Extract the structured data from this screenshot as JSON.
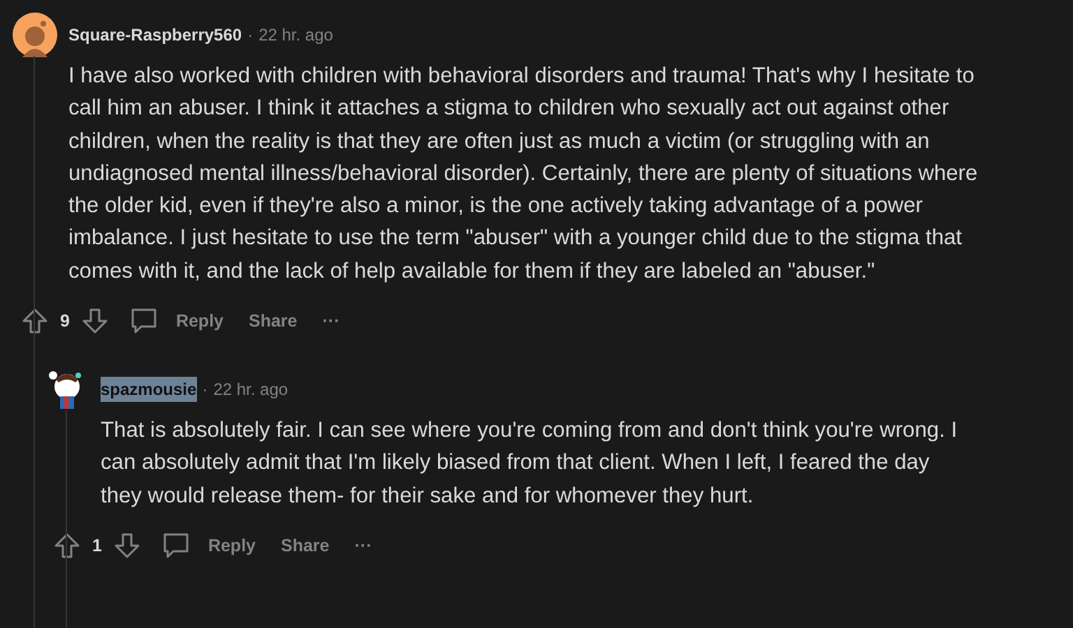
{
  "comments": [
    {
      "author": "Square-Raspberry560",
      "highlighted": false,
      "time": "22 hr. ago",
      "body": "I have also worked with children with behavioral disorders and trauma! That's why I hesitate to call him an abuser. I think it attaches a stigma to children who sexually act out against other children, when the reality is that they are often just as much a victim (or struggling with an undiagnosed mental illness/behavioral disorder). Certainly, there are plenty of situations where the older kid, even if they're also a minor, is the one actively taking advantage of a power imbalance. I just hesitate to use the term \"abuser\" with a younger child due to the stigma that comes with it, and the lack of help available for them if they are labeled an \"abuser.\"",
      "score": "9",
      "reply": "Reply",
      "share": "Share",
      "more": "···",
      "avatar": {
        "kind": "plain"
      },
      "separator": "·",
      "children": [
        {
          "author": "spazmousie",
          "highlighted": true,
          "time": "22 hr. ago",
          "body": "That is absolutely fair. I can see where you're coming from and don't think you're wrong. I can absolutely admit that I'm likely biased from that client. When I left, I feared the day they would release them- for their sake and for whomever they hurt.",
          "score": "1",
          "reply": "Reply",
          "share": "Share",
          "more": "···",
          "avatar": {
            "kind": "character"
          },
          "separator": "·"
        }
      ]
    }
  ]
}
